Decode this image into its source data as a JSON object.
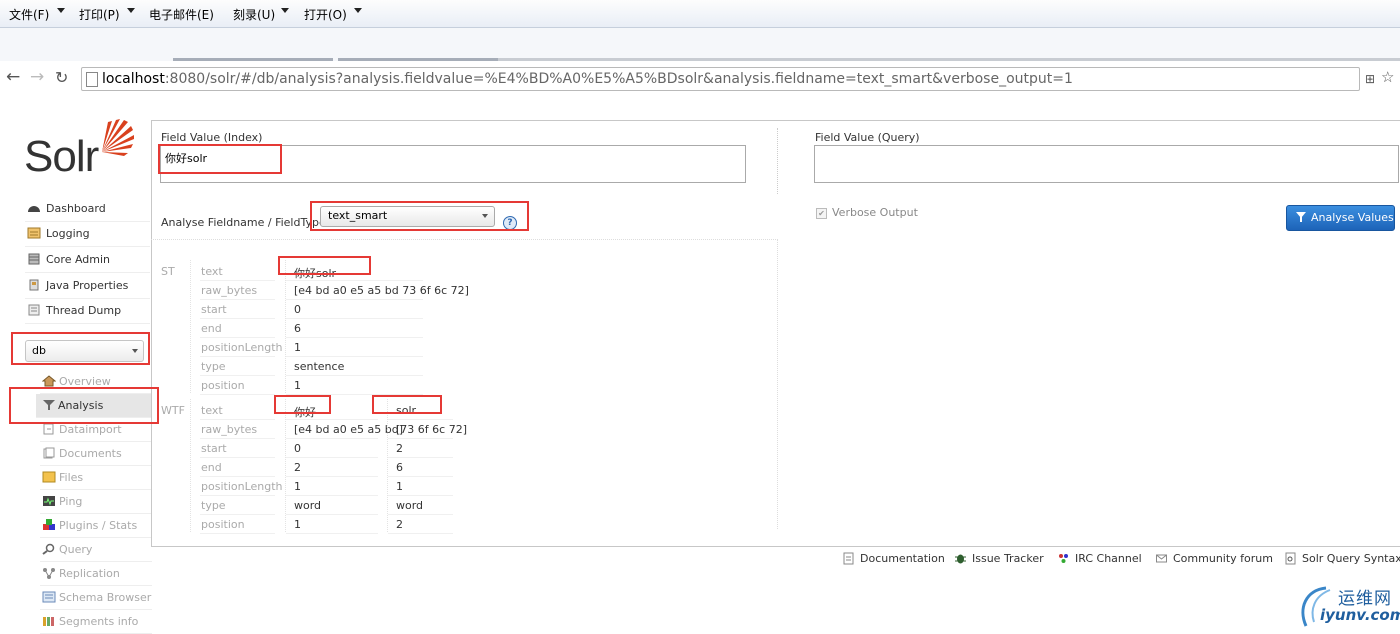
{
  "menubar": {
    "items": [
      "文件(F)",
      "打印(P)",
      "电子邮件(E)",
      "刻录(U)",
      "打开(O)"
    ]
  },
  "address": {
    "host": "localhost",
    "path": ":8080/solr/#/db/analysis?analysis.fieldvalue=%E4%BD%A0%E5%A5%BDsolr&analysis.fieldname=text_smart&verbose_output=1"
  },
  "logo": {
    "text": "Solr"
  },
  "sidebar": {
    "items": [
      {
        "label": "Dashboard",
        "icon": "dashboard-icon"
      },
      {
        "label": "Logging",
        "icon": "logging-icon"
      },
      {
        "label": "Core Admin",
        "icon": "core-admin-icon"
      },
      {
        "label": "Java Properties",
        "icon": "java-properties-icon"
      },
      {
        "label": "Thread Dump",
        "icon": "thread-dump-icon"
      }
    ],
    "core_select": "db",
    "core_menu": [
      {
        "label": "Overview",
        "icon": "home-icon"
      },
      {
        "label": "Analysis",
        "icon": "filter-icon"
      },
      {
        "label": "Dataimport",
        "icon": "dataimport-icon"
      },
      {
        "label": "Documents",
        "icon": "documents-icon"
      },
      {
        "label": "Files",
        "icon": "folder-icon"
      },
      {
        "label": "Ping",
        "icon": "ping-icon"
      },
      {
        "label": "Plugins / Stats",
        "icon": "plugins-icon"
      },
      {
        "label": "Query",
        "icon": "search-icon"
      },
      {
        "label": "Replication",
        "icon": "replication-icon"
      },
      {
        "label": "Schema Browser",
        "icon": "schema-icon"
      },
      {
        "label": "Segments info",
        "icon": "segments-icon"
      }
    ]
  },
  "analysis": {
    "index_label": "Field Value (Index)",
    "index_value": "你好solr",
    "query_label": "Field Value (Query)",
    "query_value": "",
    "fieldtype_label": "Analyse Fieldname / FieldType:",
    "fieldtype_value": "text_smart",
    "verbose_label": "Verbose Output",
    "verbose_checked": true,
    "analyse_button": "Analyse Values"
  },
  "attributes": [
    "text",
    "raw_bytes",
    "start",
    "end",
    "positionLength",
    "type",
    "position"
  ],
  "stages": [
    {
      "name": "ST",
      "tokens": [
        [
          "你好solr",
          "[e4 bd a0 e5 a5 bd 73 6f 6c 72]",
          "0",
          "6",
          "1",
          "sentence",
          "1"
        ]
      ]
    },
    {
      "name": "WTF",
      "tokens": [
        [
          "你好",
          "[e4 bd a0 e5 a5 bd]",
          "0",
          "2",
          "1",
          "word",
          "1"
        ],
        [
          "solr",
          "[73 6f 6c 72]",
          "2",
          "6",
          "1",
          "word",
          "2"
        ]
      ]
    }
  ],
  "footer": {
    "links": [
      "Documentation",
      "Issue Tracker",
      "IRC Channel",
      "Community forum",
      "Solr Query Syntax"
    ]
  },
  "watermark": {
    "cn": "运维网",
    "en": "iyunv.com"
  },
  "colors": {
    "highlight_box": "#e53935",
    "button_blue": "#1d63b8",
    "logo_orange": "#d9411e"
  }
}
